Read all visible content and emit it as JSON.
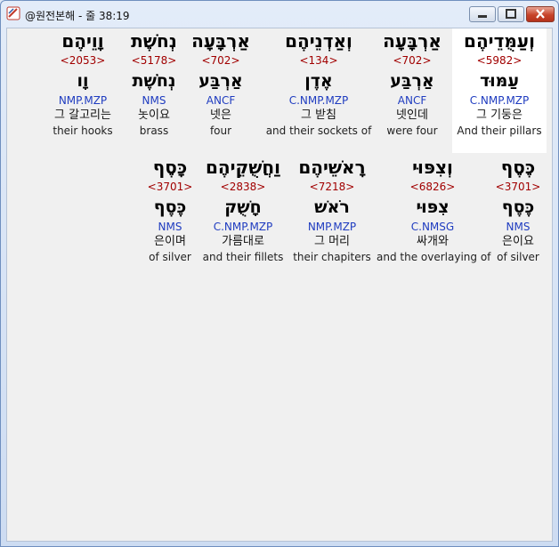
{
  "window": {
    "title": "@원전본해 - 줄 38:19"
  },
  "rows": [
    {
      "words": [
        {
          "hebrew": "וְעַמֻּדֵיהֶם",
          "strong": "<5982>",
          "lemma": "עַמּוּד",
          "morph": "C.NMP.MZP",
          "korean": "그 기둥은",
          "english": "And their pillars",
          "selected": true
        },
        {
          "hebrew": "אַרְבָּעָה",
          "strong": "<702>",
          "lemma": "אַרְבַּע",
          "morph": "ANCF",
          "korean": "넷인데",
          "english": "were four",
          "selected": false
        },
        {
          "hebrew": "וְאַדְנֵיהֶם",
          "strong": "<134>",
          "lemma": "אֶדֶן",
          "morph": "C.NMP.MZP",
          "korean": "그 받침",
          "english": "and their sockets of",
          "selected": false
        },
        {
          "hebrew": "אַרְבָּעָה",
          "strong": "<702>",
          "lemma": "אַרְבַּע",
          "morph": "ANCF",
          "korean": "넷은",
          "english": "four",
          "selected": false
        },
        {
          "hebrew": "נְחֹשֶׁת",
          "strong": "<5178>",
          "lemma": "נְחֹשֶׁת",
          "morph": "NMS",
          "korean": "놋이요",
          "english": "brass",
          "selected": false
        },
        {
          "hebrew": "וָוֵיהֶם",
          "strong": "<2053>",
          "lemma": "וָו",
          "morph": "NMP.MZP",
          "korean": "그 갈고리는",
          "english": "their hooks",
          "selected": false
        }
      ]
    },
    {
      "words": [
        {
          "hebrew": "כֶּסֶף",
          "strong": "<3701>",
          "lemma": "כֶּסֶף",
          "morph": "NMS",
          "korean": "은이요",
          "english": "of silver",
          "selected": false
        },
        {
          "hebrew": "וְצִפּוּי",
          "strong": "<6826>",
          "lemma": "צִפּוּי",
          "morph": "C.NMSG",
          "korean": "싸개와",
          "english": "and the overlaying of",
          "selected": false
        },
        {
          "hebrew": "רָאשֵׁיהֶם",
          "strong": "<7218>",
          "lemma": "רֹאשׁ",
          "morph": "NMP.MZP",
          "korean": "그 머리",
          "english": "their chapiters",
          "selected": false
        },
        {
          "hebrew": "וַחֲשֻׁקֵיהֶם",
          "strong": "<2838>",
          "lemma": "חָשֻׁק",
          "morph": "C.NMP.MZP",
          "korean": "가름대로",
          "english": "and their fillets",
          "selected": false
        },
        {
          "hebrew": "כָּסֶף",
          "strong": "<3701>",
          "lemma": "כֶּסֶף",
          "morph": "NMS",
          "korean": "은이며",
          "english": "of silver",
          "selected": false
        }
      ]
    }
  ]
}
